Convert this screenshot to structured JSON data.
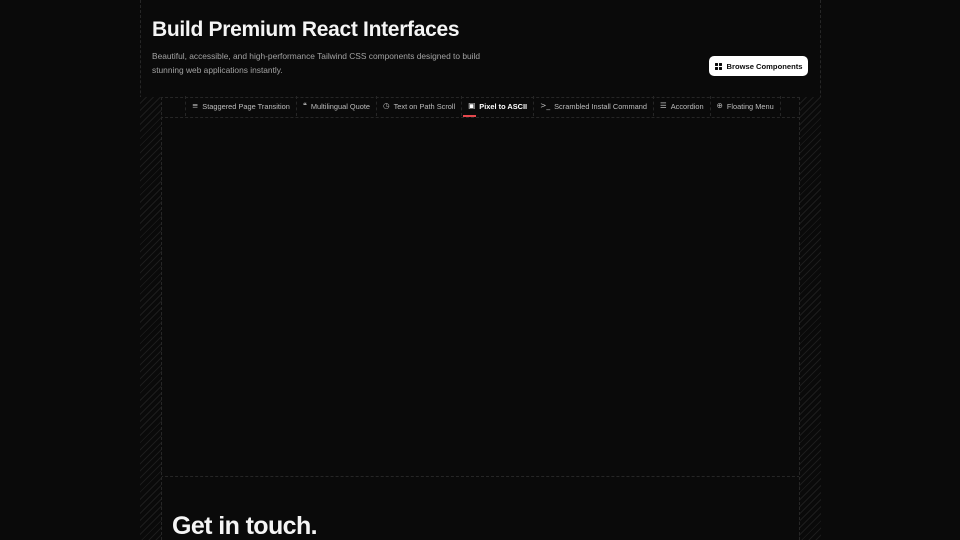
{
  "hero": {
    "title": "Build Premium React Interfaces",
    "subtitle": "Beautiful, accessible, and high-performance Tailwind CSS components designed to build stunning web applications instantly."
  },
  "actions": {
    "browse_label": "Browse Components",
    "browse_icon": "grid-icon"
  },
  "tabs": [
    {
      "label": "Staggered Page Transition",
      "icon": "lines-icon",
      "glyph": "≡"
    },
    {
      "label": "Multilingual Quote",
      "icon": "quote-icon",
      "glyph": "❝"
    },
    {
      "label": "Text on Path Scroll",
      "icon": "clock-icon",
      "glyph": "◷"
    },
    {
      "label": "Pixel to ASCII",
      "icon": "image-icon",
      "glyph": "▣",
      "active": true
    },
    {
      "label": "Scrambled Install Command",
      "icon": "terminal-icon",
      "glyph": ">_"
    },
    {
      "label": "Accordion",
      "icon": "accordion-icon",
      "glyph": "☰"
    },
    {
      "label": "Floating Menu",
      "icon": "plus-circle-icon",
      "glyph": "⊕"
    }
  ],
  "contact": {
    "title": "Get in touch."
  },
  "colors": {
    "background": "#0a0a0a",
    "accent": "#e5484d",
    "button_bg": "#ffffff"
  }
}
